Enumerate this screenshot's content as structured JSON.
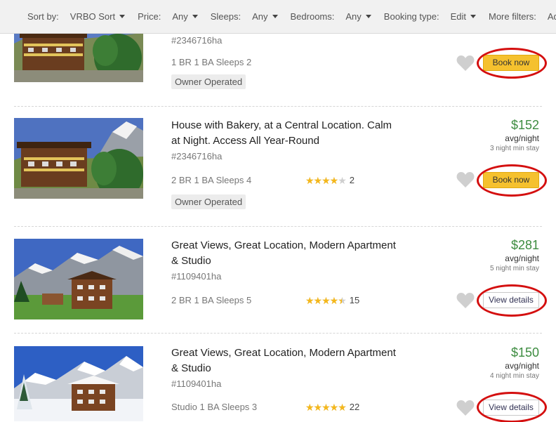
{
  "filters": {
    "sort_label": "Sort by:",
    "sort_value": "VRBO Sort",
    "price_label": "Price:",
    "price_value": "Any",
    "sleeps_label": "Sleeps:",
    "sleeps_value": "Any",
    "bedrooms_label": "Bedrooms:",
    "bedrooms_value": "Any",
    "booking_label": "Booking type:",
    "booking_value": "Edit",
    "more_label": "More filters:",
    "add_label": "Add+"
  },
  "listings": [
    {
      "title": "",
      "id": "#2346716ha",
      "specs": "1 BR 1 BA Sleeps 2",
      "badge": "Owner Operated",
      "button": "Book now"
    },
    {
      "title": "House with Bakery, at a Central Location. Calm at Night. Access All Year-Round",
      "id": "#2346716ha",
      "specs": "2 BR 1 BA Sleeps 4",
      "badge": "Owner Operated",
      "rating": 4,
      "review_count": "2",
      "price": "$152",
      "price_unit": "avg/night",
      "min_stay": "3 night min stay",
      "button": "Book now"
    },
    {
      "title": "Great Views, Great Location, Modern Apartment & Studio",
      "id": "#1109401ha",
      "specs": "2 BR 1 BA Sleeps 5",
      "rating": 4.5,
      "review_count": "15",
      "price": "$281",
      "price_unit": "avg/night",
      "min_stay": "5 night min stay",
      "button": "View details"
    },
    {
      "title": "Great Views, Great Location, Modern Apartment & Studio",
      "id": "#1109401ha",
      "specs": "Studio 1 BA Sleeps 3",
      "rating": 5,
      "review_count": "22",
      "price": "$150",
      "price_unit": "avg/night",
      "min_stay": "4 night min stay",
      "button": "View details"
    }
  ],
  "colors": {
    "price": "#3d8c40",
    "book_button": "#f5c12e",
    "highlight_circle": "#d40f0f",
    "star": "#f5b81c"
  },
  "icons": {
    "favorite": "heart-icon",
    "rating": "star-icon",
    "dropdown": "caret-down-icon"
  }
}
